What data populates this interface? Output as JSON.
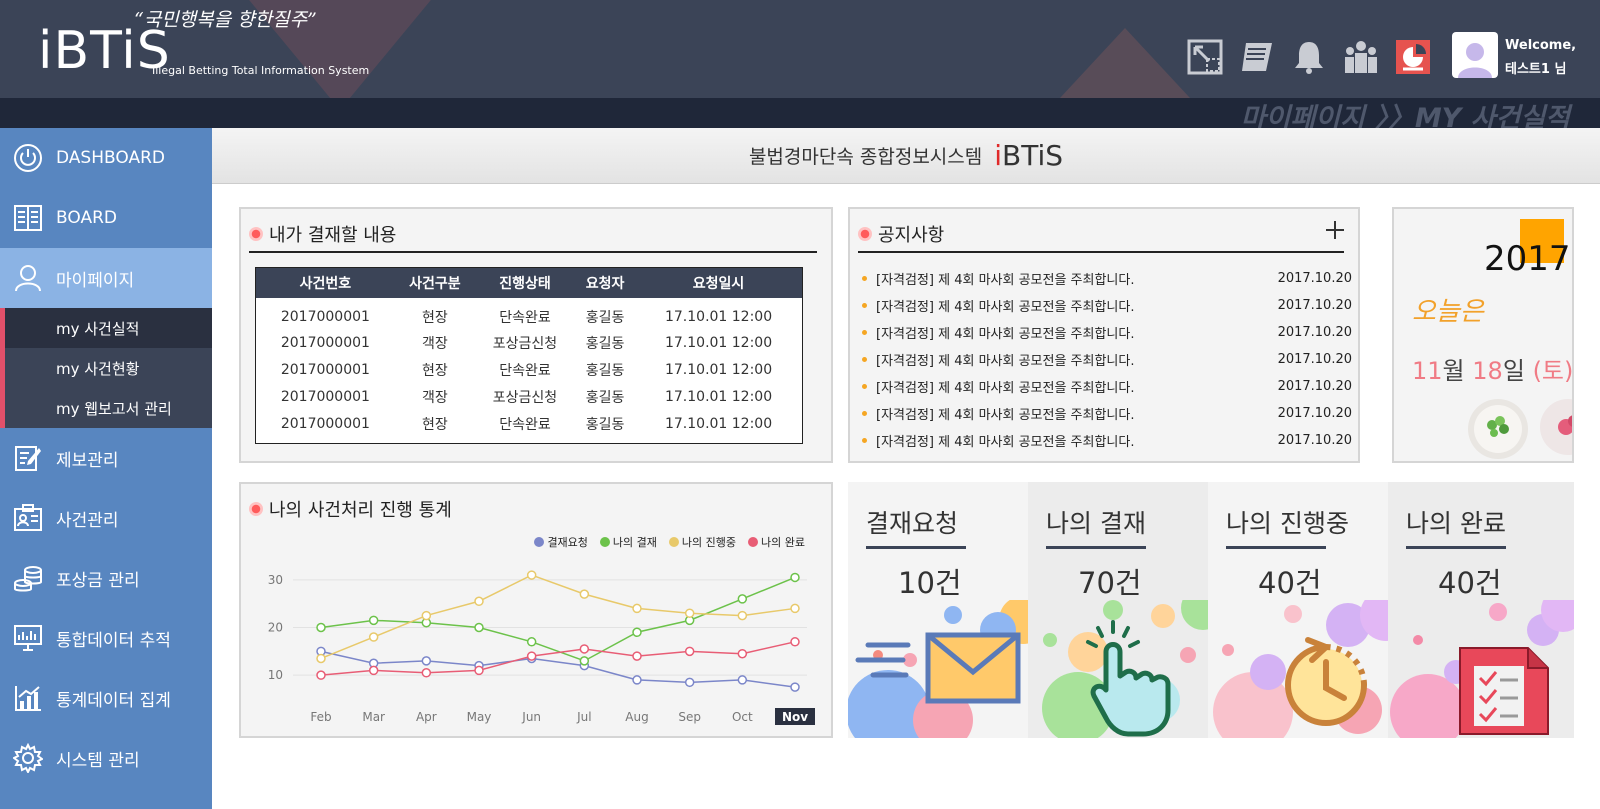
{
  "header": {
    "logo": "iBTiS",
    "logo_subtitle": "Illegal Betting Total Information System",
    "slogan": "“국민행복을 향한질주”",
    "icons": [
      "expand-icon",
      "book-icon",
      "bell-icon",
      "group-icon",
      "report-icon"
    ],
    "welcome": "Welcome,",
    "user_name": "테스트1 님"
  },
  "breadcrumb": "마이페이지 〉〉MY 사건실적",
  "title_bar": {
    "text": "불법경마단속 종합정보시스템",
    "brand_i": "i",
    "brand_rest": "BTiS"
  },
  "sidebar": {
    "items": [
      {
        "label": "DASHBOARD",
        "icon": "power-icon"
      },
      {
        "label": "BOARD",
        "icon": "board-icon"
      },
      {
        "label": "마이페이지",
        "icon": "user-icon"
      },
      {
        "label": "제보관리",
        "icon": "edit-icon"
      },
      {
        "label": "사건관리",
        "icon": "case-icon"
      },
      {
        "label": "포상금 관리",
        "icon": "coins-icon"
      },
      {
        "label": "통합데이터 추적",
        "icon": "monitor-icon"
      },
      {
        "label": "통계데이터 집계",
        "icon": "chart-icon"
      },
      {
        "label": "시스템 관리",
        "icon": "gear-icon"
      }
    ],
    "subitems": [
      "my 사건실적",
      "my 사건현황",
      "my 웹보고서 관리"
    ]
  },
  "approval": {
    "title": "내가 결재할 내용",
    "columns": [
      "사건번호",
      "사건구분",
      "진행상태",
      "요청자",
      "요청일시"
    ],
    "rows": [
      [
        "2017000001",
        "현장",
        "단속완료",
        "홍길동",
        "17.10.01 12:00"
      ],
      [
        "2017000001",
        "객장",
        "포상금신청",
        "홍길동",
        "17.10.01 12:00"
      ],
      [
        "2017000001",
        "현장",
        "단속완료",
        "홍길동",
        "17.10.01 12:00"
      ],
      [
        "2017000001",
        "객장",
        "포상금신청",
        "홍길동",
        "17.10.01 12:00"
      ],
      [
        "2017000001",
        "현장",
        "단속완료",
        "홍길동",
        "17.10.01 12:00"
      ]
    ]
  },
  "notice": {
    "title": "공지사항",
    "items": [
      {
        "text": "[자격검정] 제 4회 마사회 공모전을 주최합니다.",
        "date": "2017.10.20"
      },
      {
        "text": "[자격검정] 제 4회 마사회 공모전을 주최합니다.",
        "date": "2017.10.20"
      },
      {
        "text": "[자격검정] 제 4회 마사회 공모전을 주최합니다.",
        "date": "2017.10.20"
      },
      {
        "text": "[자격검정] 제 4회 마사회 공모전을 주최합니다.",
        "date": "2017.10.20"
      },
      {
        "text": "[자격검정] 제 4회 마사회 공모전을 주최합니다.",
        "date": "2017.10.20"
      },
      {
        "text": "[자격검정] 제 4회 마사회 공모전을 주최합니다.",
        "date": "2017.10.20"
      },
      {
        "text": "[자격검정] 제 4회 마사회 공모전을 주최합니다.",
        "date": "2017.10.20"
      }
    ]
  },
  "calendar": {
    "year": "2017",
    "today_label": "오늘은",
    "month": "11",
    "month_unit": "월",
    "day": "18",
    "day_unit": "일",
    "weekday": "(토)"
  },
  "stats_chart_title": "나의 사건처리 진행 통계",
  "chart_data": {
    "type": "line",
    "categories": [
      "Feb",
      "Mar",
      "Apr",
      "May",
      "Jun",
      "Jul",
      "Aug",
      "Sep",
      "Oct",
      "Nov"
    ],
    "highlight_category": "Nov",
    "ylim": [
      5,
      35
    ],
    "yticks": [
      10,
      20,
      30
    ],
    "grid": true,
    "legend_position": "top-right",
    "series": [
      {
        "name": "결재요청",
        "color": "#7b86c9",
        "values": [
          15,
          12.5,
          13,
          12,
          13.5,
          12,
          9,
          8.5,
          9,
          7.5
        ]
      },
      {
        "name": "나의 결재",
        "color": "#6cc24a",
        "values": [
          20,
          21.5,
          21,
          20,
          17,
          13,
          19,
          21.5,
          26,
          30.5
        ]
      },
      {
        "name": "나의 진행중",
        "color": "#e8c96a",
        "values": [
          13.5,
          18,
          22.5,
          25.5,
          31,
          27,
          24,
          23,
          22.5,
          24
        ]
      },
      {
        "name": "나의 완료",
        "color": "#e85d75",
        "values": [
          10,
          11,
          10.5,
          11,
          14,
          15.5,
          14,
          15,
          14.5,
          17
        ]
      }
    ]
  },
  "tiles": [
    {
      "label": "결재요청",
      "value": "10건",
      "bg": "#f4f4f4",
      "icon": "envelope-icon"
    },
    {
      "label": "나의 결재",
      "value": "70건",
      "bg": "#ececec",
      "icon": "hand-pointer-icon"
    },
    {
      "label": "나의 진행중",
      "value": "40건",
      "bg": "#f4f4f4",
      "icon": "clock-icon"
    },
    {
      "label": "나의 완료",
      "value": "40건",
      "bg": "#ececec",
      "icon": "document-icon"
    }
  ]
}
